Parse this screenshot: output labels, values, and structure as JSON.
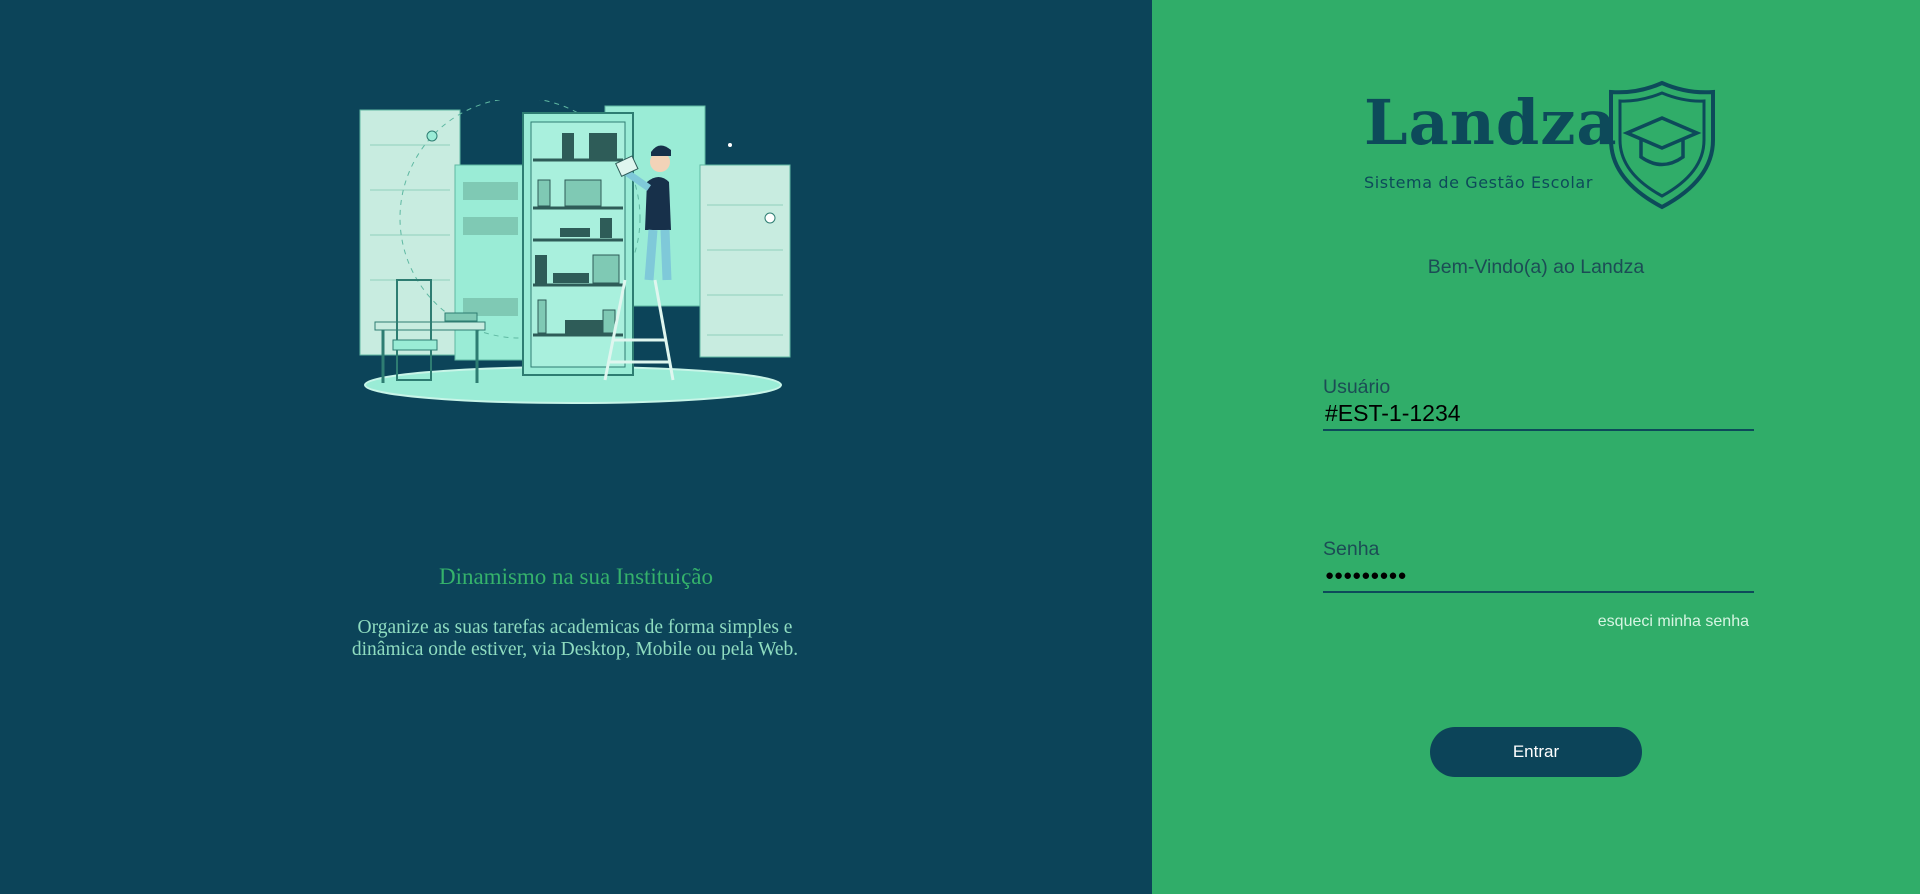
{
  "left": {
    "tagline": "Dinamismo na sua Instituição",
    "description": "Organize as suas tarefas academicas de forma simples e dinâmica onde estiver, via Desktop, Mobile ou pela Web.",
    "illustration_icon": "library-person-on-ladder-illustration"
  },
  "logo": {
    "name": "Landza",
    "subtitle": "Sistema de Gestão Escolar",
    "icon": "graduation-cap-shield-icon"
  },
  "welcome": "Bem-Vindo(a) ao Landza",
  "form": {
    "username_label": "Usuário",
    "username_value": "#EST-1-1234",
    "password_label": "Senha",
    "password_value": "●●●●●●●●●",
    "forgot_label": "esqueci minha senha",
    "submit_label": "Entrar"
  },
  "colors": {
    "left_background": "#0c4459",
    "right_background": "#30ad69",
    "brand": "#0d4a5a",
    "tagline": "#35b26b",
    "illustration_mint": "#9aecd6"
  }
}
